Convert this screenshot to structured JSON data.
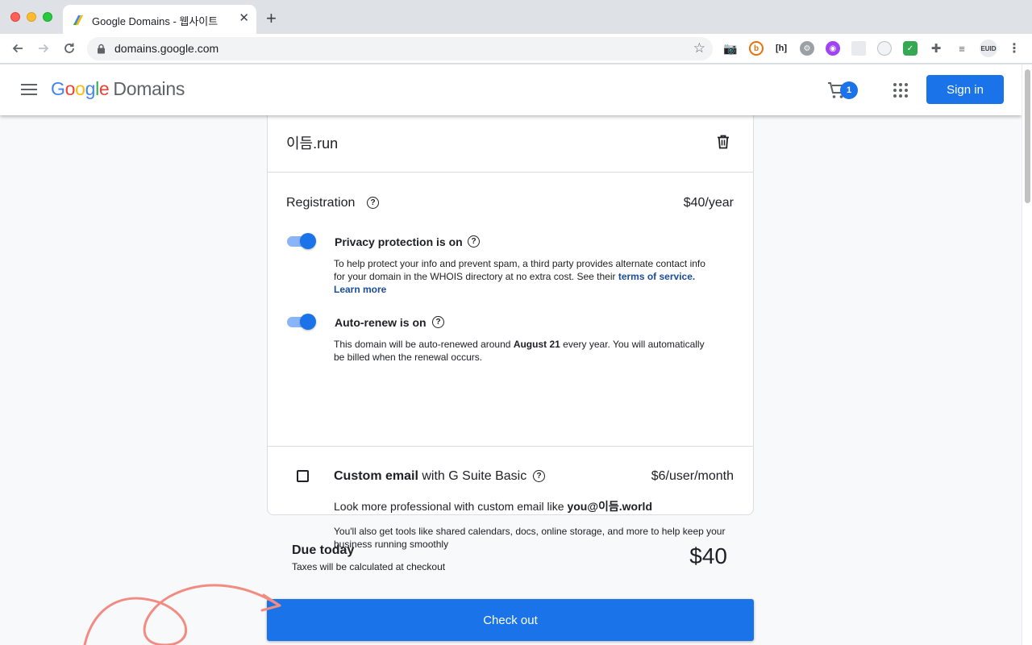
{
  "browser": {
    "tab_title": "Google Domains - 웹사이트",
    "url": "domains.google.com",
    "extension_badge": "EUID"
  },
  "header": {
    "brand_letters": [
      "G",
      "o",
      "o",
      "g",
      "l",
      "e"
    ],
    "brand_suffix": "Domains",
    "cart_count": "1",
    "signin_label": "Sign in"
  },
  "cart_item": {
    "domain": "이듬.run"
  },
  "registration": {
    "title": "Registration",
    "price": "$40/year",
    "privacy": {
      "title": "Privacy protection is on",
      "text": "To help protect your info and prevent spam, a third party provides alternate contact info for your domain in the WHOIS directory at no extra cost. See their",
      "link1": "terms of service.",
      "link2": "Learn more",
      "enabled": true
    },
    "autorenew": {
      "title": "Auto-renew is on",
      "text_before": "This domain will be auto-renewed around",
      "date": "August 21",
      "text_after": "every year. You will automatically be billed when the renewal occurs.",
      "enabled": true
    }
  },
  "email_offer": {
    "title_bold": "Custom email",
    "title_rest": "with G Suite Basic",
    "price": "$6/user/month",
    "sub_text": "Look more professional with custom email like",
    "sub_example": "you@이듬.world",
    "desc": "You'll also get tools like shared calendars, docs, online storage, and more to help keep your business running smoothly",
    "checked": false
  },
  "summary": {
    "due_title": "Due today",
    "due_sub": "Taxes will be calculated at checkout",
    "amount": "$40"
  },
  "checkout_label": "Check out",
  "colors": {
    "primary": "#1a73e8",
    "annotation_arrow": "#f28b82"
  }
}
